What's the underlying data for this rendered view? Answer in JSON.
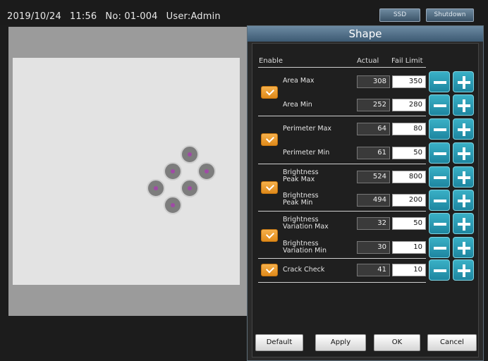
{
  "header": {
    "date": "2019/10/24",
    "time": "11:56",
    "number": "No: 01-004",
    "user": "User:Admin",
    "ssd_label": "SSD",
    "shutdown_label": "Shutdown"
  },
  "panel": {
    "title": "Shape",
    "col_enable": "Enable",
    "col_actual": "Actual",
    "col_fail_limit": "Fail Limit"
  },
  "groups": [
    {
      "enabled": true,
      "rows": [
        {
          "label": "Area Max",
          "actual": "308",
          "limit": "350"
        },
        {
          "label": "Area Min",
          "actual": "252",
          "limit": "280"
        }
      ]
    },
    {
      "enabled": true,
      "rows": [
        {
          "label": "Perimeter Max",
          "actual": "64",
          "limit": "80"
        },
        {
          "label": "Perimeter Min",
          "actual": "61",
          "limit": "50"
        }
      ]
    },
    {
      "enabled": true,
      "rows": [
        {
          "label_line1": "Brightness",
          "label_line2": "Peak Max",
          "actual": "524",
          "limit": "800"
        },
        {
          "label_line1": "Brightness",
          "label_line2": "Peak Min",
          "actual": "494",
          "limit": "200"
        }
      ]
    },
    {
      "enabled": true,
      "rows": [
        {
          "label_line1": "Brightness",
          "label_line2": "Variation Max",
          "actual": "32",
          "limit": "50"
        },
        {
          "label_line1": "Brightness",
          "label_line2": "Variation Min",
          "actual": "30",
          "limit": "10"
        }
      ]
    },
    {
      "enabled": true,
      "rows": [
        {
          "label": "Crack Check",
          "actual": "41",
          "limit": "10"
        }
      ]
    }
  ],
  "buttons": {
    "default": "Default",
    "apply": "Apply",
    "ok": "OK",
    "cancel": "Cancel"
  },
  "icons": {
    "checkbox": "checkmark-icon",
    "decrement": "minus-icon",
    "increment": "plus-icon"
  },
  "colors": {
    "accent_cyan": "#2a9cb4",
    "checkbox_orange": "#f0a030",
    "header_blue": "#5a7a94"
  }
}
